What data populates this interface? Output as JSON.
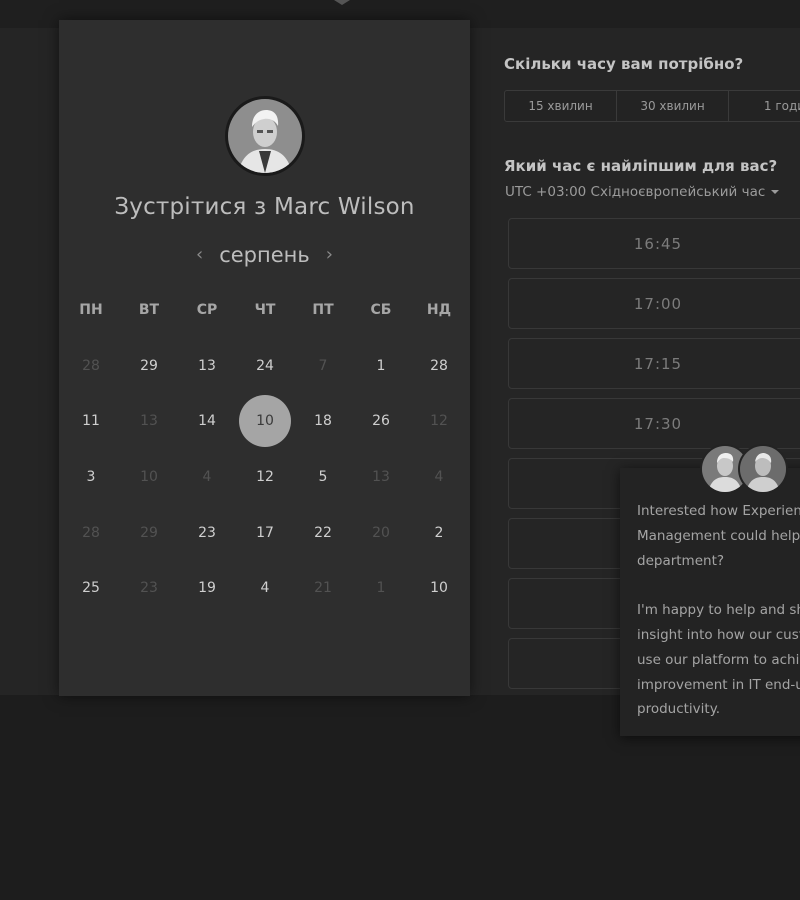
{
  "calendar": {
    "host_title": "Зустрітися з Marc Wilson",
    "month": "серпень",
    "prev_icon": "chevron-left-icon",
    "next_icon": "chevron-right-icon",
    "weekdays": [
      "ПН",
      "ВТ",
      "СР",
      "ЧТ",
      "ПТ",
      "СБ",
      "НД"
    ],
    "weeks": [
      [
        {
          "d": "28",
          "a": false
        },
        {
          "d": "29",
          "a": true
        },
        {
          "d": "13",
          "a": true
        },
        {
          "d": "24",
          "a": true
        },
        {
          "d": "7",
          "a": false
        },
        {
          "d": "1",
          "a": true
        },
        {
          "d": "28",
          "a": true
        }
      ],
      [
        {
          "d": "11",
          "a": true
        },
        {
          "d": "13",
          "a": false
        },
        {
          "d": "14",
          "a": true
        },
        {
          "d": "10",
          "a": true,
          "sel": true
        },
        {
          "d": "18",
          "a": true
        },
        {
          "d": "26",
          "a": true
        },
        {
          "d": "12",
          "a": false
        }
      ],
      [
        {
          "d": "3",
          "a": true
        },
        {
          "d": "10",
          "a": false
        },
        {
          "d": "4",
          "a": false
        },
        {
          "d": "12",
          "a": true
        },
        {
          "d": "5",
          "a": true
        },
        {
          "d": "13",
          "a": false
        },
        {
          "d": "4",
          "a": false
        }
      ],
      [
        {
          "d": "28",
          "a": false
        },
        {
          "d": "29",
          "a": false
        },
        {
          "d": "23",
          "a": true
        },
        {
          "d": "17",
          "a": true
        },
        {
          "d": "22",
          "a": true
        },
        {
          "d": "20",
          "a": false
        },
        {
          "d": "2",
          "a": true
        }
      ],
      [
        {
          "d": "25",
          "a": true
        },
        {
          "d": "23",
          "a": false
        },
        {
          "d": "19",
          "a": true
        },
        {
          "d": "4",
          "a": true
        },
        {
          "d": "21",
          "a": false
        },
        {
          "d": "1",
          "a": false
        },
        {
          "d": "10",
          "a": true
        }
      ]
    ]
  },
  "scheduler": {
    "duration_question": "Скільки часу вам потрібно?",
    "durations": [
      "15 хвилин",
      "30 хвилин",
      "1 годи"
    ],
    "time_question": "Який час є найліпшим для вас?",
    "timezone": "UTC +03:00 Східноєвропейський час",
    "slots": [
      "16:45",
      "17:00",
      "17:15",
      "17:30",
      "",
      "",
      "",
      ""
    ]
  },
  "chat": {
    "lines": [
      "Interested how Experienc",
      "Management could help y",
      "department?",
      "",
      "I'm happy to help and sha",
      "insight into how our custo",
      "use our platform to achiev",
      "improvement in IT end-us",
      "productivity."
    ]
  }
}
